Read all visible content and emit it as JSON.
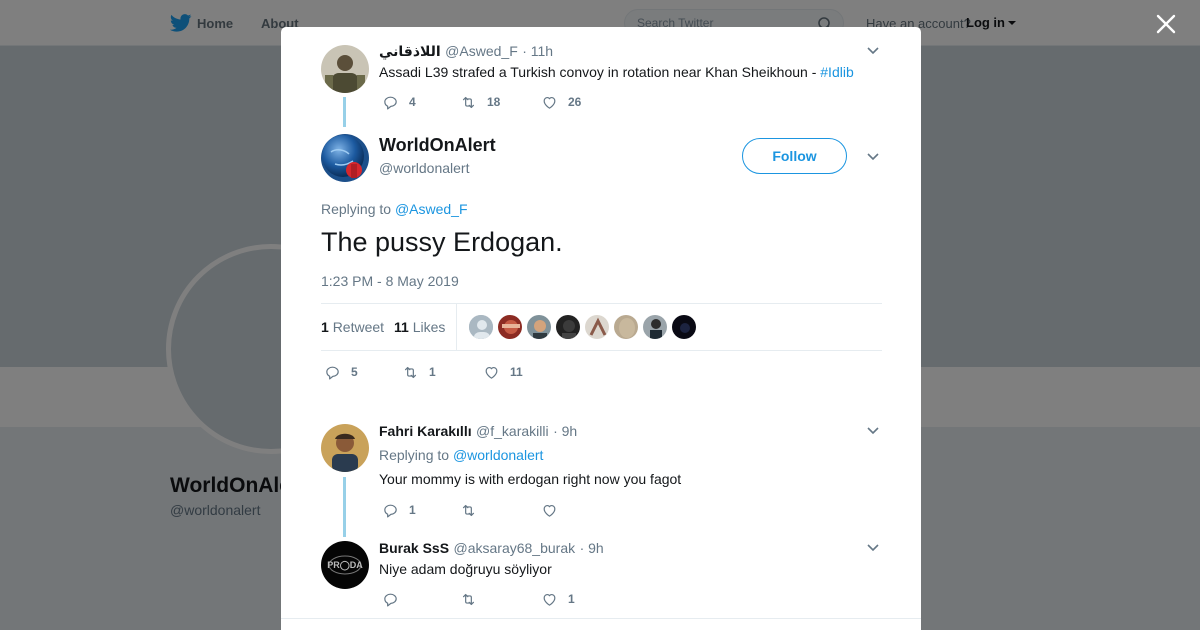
{
  "topbar": {
    "home_label": "Home",
    "about_label": "About",
    "search_placeholder": "Search Twitter",
    "account_text": "Have an account?",
    "login_label": "Log in"
  },
  "background_profile": {
    "name": "WorldOnAlert",
    "handle": "@worldonalert"
  },
  "parent_tweet": {
    "name": "اللاذقاني",
    "handle": "@Aswed_F",
    "time": "· 11h",
    "text": "Assadi L39 strafed a Turkish convoy in rotation near Khan Sheikhoun - ",
    "hashtag": "#Idlib",
    "replies": "4",
    "retweets": "18",
    "likes": "26"
  },
  "main_tweet": {
    "name": "WorldOnAlert",
    "handle": "@worldonalert",
    "follow_label": "Follow",
    "replying_prefix": "Replying to ",
    "replying_to": "@Aswed_F",
    "text": "The pussy Erdogan.",
    "timestamp": "1:23 PM - 8 May 2019",
    "retweet_count": "1",
    "retweet_label": "Retweet",
    "like_count": "11",
    "like_label": "Likes",
    "replies": "5",
    "retweets": "1",
    "likes": "11"
  },
  "replies": [
    {
      "name": "Fahri Karakıllı",
      "handle": "@f_karakilli",
      "time": "· 9h",
      "replying_prefix": "Replying to ",
      "replying_to": "@worldonalert",
      "text": "Your mommy is with erdogan right now you fagot",
      "replies": "1",
      "retweets": "",
      "likes": ""
    },
    {
      "name": "Burak SsS",
      "handle": "@aksaray68_burak",
      "time": "· 9h",
      "text": "Niye adam doğruyu söyliyor",
      "replies": "",
      "retweets": "",
      "likes": "1"
    }
  ],
  "colors": {
    "accent": "#1b95e0",
    "thread_line": "#97d0e8",
    "muted": "#657786"
  },
  "icons": [
    "twitter-bird-icon",
    "search-icon",
    "close-icon",
    "chevron-down-icon",
    "reply-icon",
    "retweet-icon",
    "like-icon"
  ]
}
